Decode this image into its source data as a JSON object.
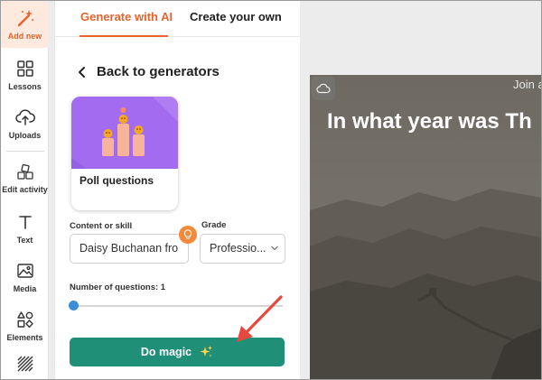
{
  "sidebar": {
    "items": [
      {
        "label": "Add new",
        "icon": "magic-wand-icon"
      },
      {
        "label": "Lessons",
        "icon": "grid-icon"
      },
      {
        "label": "Uploads",
        "icon": "cloud-upload-icon"
      },
      {
        "label": "Edit activity",
        "icon": "blocks-icon"
      },
      {
        "label": "Text",
        "icon": "text-icon"
      },
      {
        "label": "Media",
        "icon": "image-icon"
      },
      {
        "label": "Elements",
        "icon": "shapes-icon"
      },
      {
        "label": "",
        "icon": "pattern-icon"
      }
    ],
    "active_color": "#e8622c"
  },
  "panel": {
    "tabs": [
      {
        "label": "Generate with AI"
      },
      {
        "label": "Create your own"
      }
    ],
    "back_label": "Back to generators",
    "card": {
      "title": "Poll questions"
    },
    "content_label": "Content or skill",
    "content_value": "Daisy Buchanan fro",
    "grade_label": "Grade",
    "grade_value": "Professio...",
    "num_questions_label": "Number of questions: 1",
    "num_questions": 1,
    "magic_button_label": "Do magic"
  },
  "preview": {
    "join_text": "Join a",
    "question_text": "In what year was Th"
  },
  "colors": {
    "accent": "#e8622c",
    "button": "#1f8f77",
    "slider": "#3b8fd9",
    "annotation_arrow": "#e5483e"
  }
}
